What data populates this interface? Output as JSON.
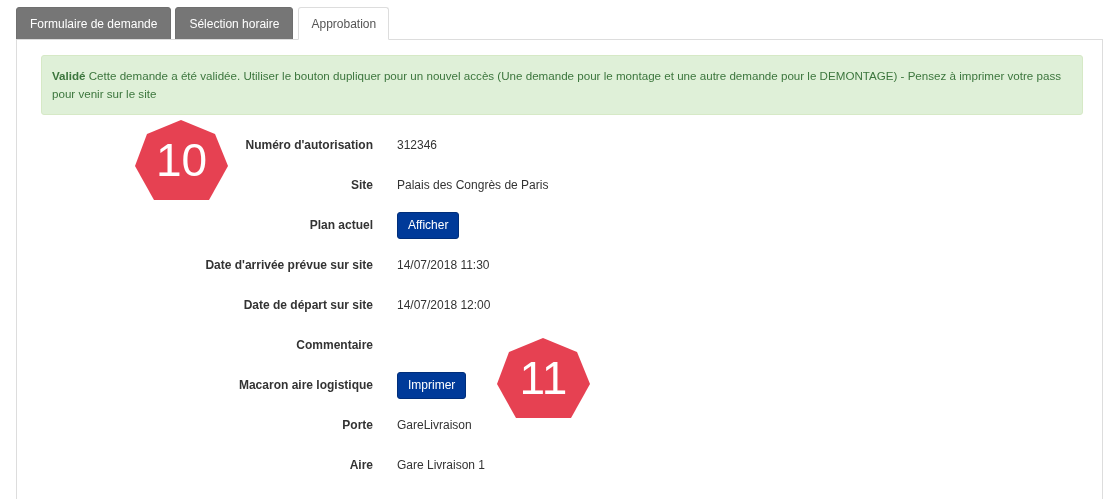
{
  "tabs": [
    {
      "label": "Formulaire de demande",
      "selected": false
    },
    {
      "label": "Sélection horaire",
      "selected": false
    },
    {
      "label": "Approbation",
      "selected": true
    }
  ],
  "alert": {
    "text": "**Validé** Cette demande a été validée. Utiliser le bouton dupliquer pour un nouvel accès (Une demande pour le montage et une autre demande pour le DEMONTAGE) - Pensez à imprimer votre pass pour venir sur le site"
  },
  "fields": [
    {
      "label": "Numéro d'autorisation",
      "kind": "text",
      "value": "312346"
    },
    {
      "label": "Site",
      "kind": "text",
      "value": "Palais des Congrès de Paris"
    },
    {
      "label": "Plan actuel",
      "kind": "button",
      "value": "Afficher"
    },
    {
      "label": "Date d'arrivée prévue sur site",
      "kind": "text",
      "value": "14/07/2018 11:30"
    },
    {
      "label": "Date de départ sur site",
      "kind": "text",
      "value": "14/07/2018 12:00"
    },
    {
      "label": "Commentaire"
    },
    {
      "label": "Macaron aire logistique",
      "kind": "button",
      "value": "Imprimer"
    },
    {
      "label": "Porte",
      "kind": "text",
      "value": "GareLivraison"
    },
    {
      "label": "Aire",
      "kind": "text",
      "value": "Gare Livraison 1"
    }
  ],
  "callouts": [
    {
      "label": "10"
    },
    {
      "label": "11"
    }
  ]
}
